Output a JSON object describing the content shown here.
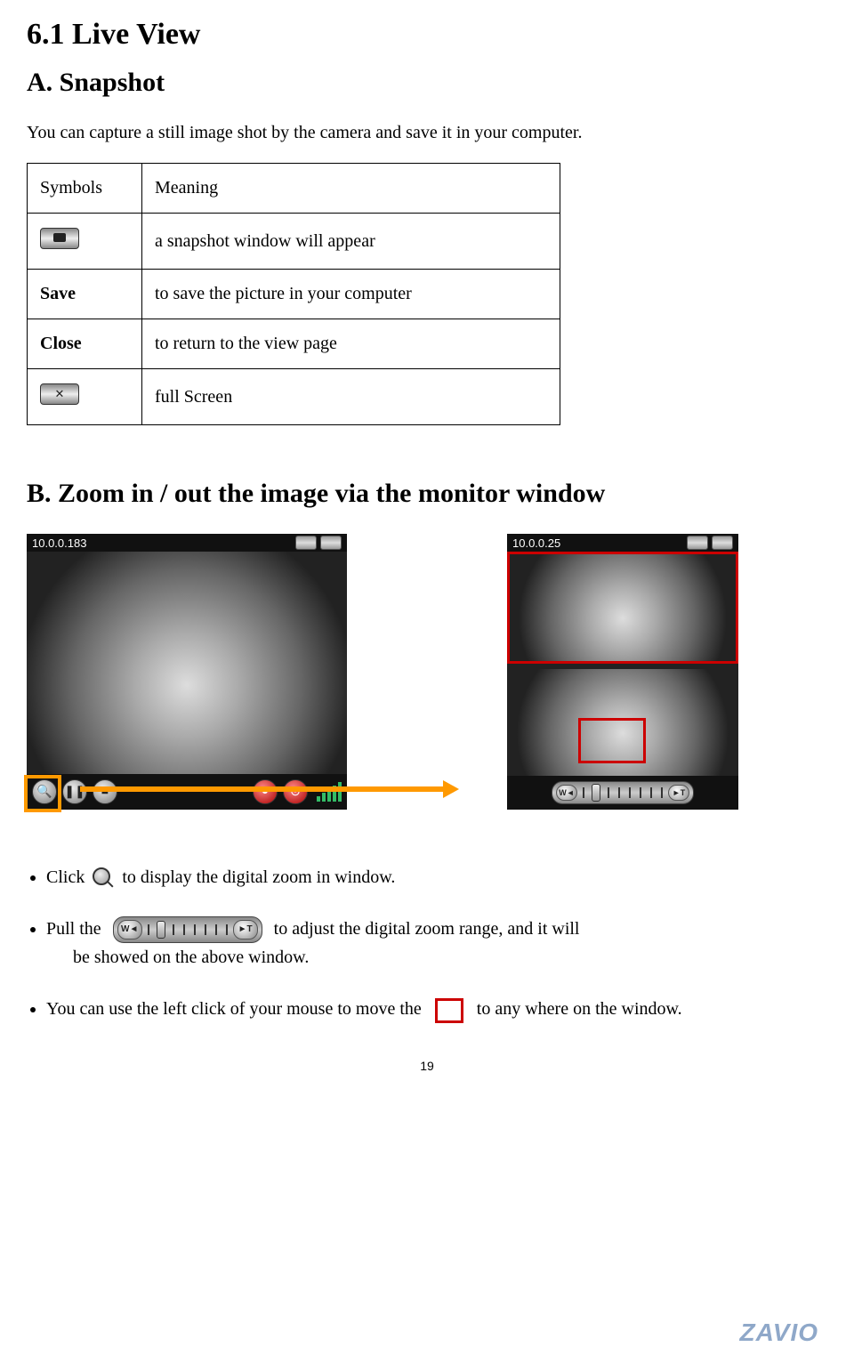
{
  "headings": {
    "section": "6.1 Live View",
    "sub_a": "A. Snapshot",
    "intro": "You can capture a still image shot by the camera and save it in your computer.",
    "sub_b": "B. Zoom in / out the image via the monitor window"
  },
  "table": {
    "header_symbols": "Symbols",
    "header_meaning": "Meaning",
    "rows": [
      {
        "symbol_type": "icon-snapshot",
        "symbol_text": "",
        "meaning": "a snapshot window will appear"
      },
      {
        "symbol_type": "text-bold",
        "symbol_text": "Save",
        "meaning": "to save the picture in your computer"
      },
      {
        "symbol_type": "text-bold",
        "symbol_text": "Close",
        "meaning": "to return to the view page"
      },
      {
        "symbol_type": "icon-fullscreen",
        "symbol_text": "",
        "meaning": "full Screen"
      }
    ]
  },
  "monitor_left": {
    "ip": "10.0.0.183"
  },
  "monitor_right": {
    "ip": "10.0.0.25"
  },
  "slider": {
    "left_label": "W◄",
    "right_label": "►T"
  },
  "bullets": {
    "b1_a": "Click",
    "b1_b": "to display the digital zoom in window.",
    "b2_a": "Pull the",
    "b2_b": "to adjust the digital zoom range, and it will",
    "b2_c": "be showed on the above window.",
    "b3_a": "You can use the left click of your mouse to move the",
    "b3_b": "to any where on the window."
  },
  "page_number": "19",
  "logo": "ZAVIO"
}
